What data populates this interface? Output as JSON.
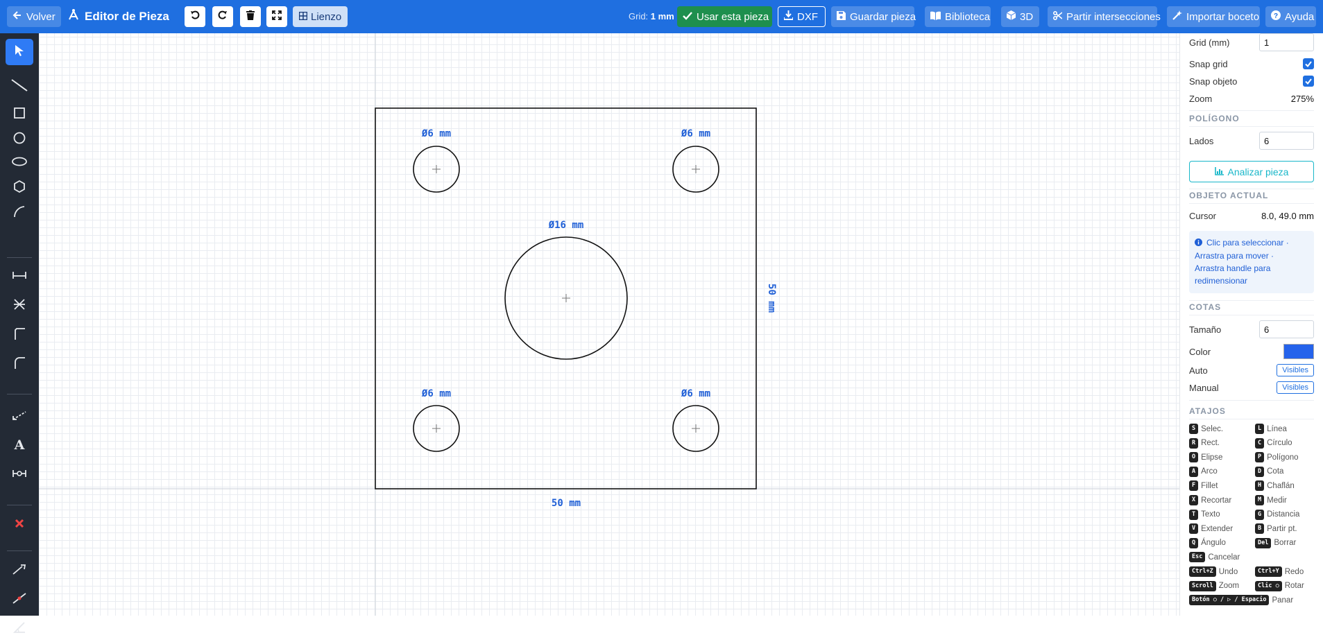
{
  "header": {
    "back_label": "Volver",
    "title": "Editor de Pieza",
    "lienzo_label": "Lienzo",
    "grid_prefix": "Grid:",
    "grid_value": "1 mm",
    "usar_label": "Usar esta pieza",
    "dxf_label": "DXF",
    "guardar_label": "Guardar pieza",
    "biblioteca_label": "Biblioteca",
    "d3_label": "3D",
    "partir_label": "Partir intersecciones",
    "importar_label": "Importar boceto",
    "ayuda_label": "Ayuda"
  },
  "drawing": {
    "hole_small_label": "Ø6 mm",
    "hole_big_label": "Ø16 mm",
    "width_label": "50 mm",
    "height_label": "50 mm",
    "small_hole_diameter_mm": 6,
    "big_hole_diameter_mm": 16,
    "plate_width_mm": 50,
    "plate_height_mm": 50
  },
  "panel": {
    "grid_label": "Grid (mm)",
    "grid_value": "1",
    "snap_grid_label": "Snap grid",
    "snap_objeto_label": "Snap objeto",
    "zoom_label": "Zoom",
    "zoom_value": "275%",
    "poligono_title": "POLÍGONO",
    "lados_label": "Lados",
    "lados_value": "6",
    "analizar_label": "Analizar pieza",
    "objeto_title": "OBJETO ACTUAL",
    "cursor_label": "Cursor",
    "cursor_value": "8.0, 49.0 mm",
    "info_line1": "Clic para seleccionar ·",
    "info_line2": "Arrastra para mover ·",
    "info_line3": "Arrastra handle para",
    "info_line4": "redimensionar",
    "cotas_title": "COTAS",
    "tamano_label": "Tamaño",
    "tamano_value": "6",
    "color_label": "Color",
    "color_value": "#2563eb",
    "auto_label": "Auto",
    "auto_value": "Visibles",
    "manual_label": "Manual",
    "manual_value": "Visibles",
    "atajos_title": "ATAJOS"
  },
  "shortcuts": [
    {
      "key": "S",
      "label": "Selec."
    },
    {
      "key": "L",
      "label": "Línea"
    },
    {
      "key": "R",
      "label": "Rect."
    },
    {
      "key": "C",
      "label": "Círculo"
    },
    {
      "key": "O",
      "label": "Elipse"
    },
    {
      "key": "P",
      "label": "Polígono"
    },
    {
      "key": "A",
      "label": "Arco"
    },
    {
      "key": "D",
      "label": "Cota"
    },
    {
      "key": "F",
      "label": "Fillet"
    },
    {
      "key": "H",
      "label": "Chaflán"
    },
    {
      "key": "X",
      "label": "Recortar"
    },
    {
      "key": "M",
      "label": "Medir"
    },
    {
      "key": "T",
      "label": "Texto"
    },
    {
      "key": "G",
      "label": "Distancia"
    },
    {
      "key": "V",
      "label": "Extender"
    },
    {
      "key": "B",
      "label": "Partir pt."
    },
    {
      "key": "Q",
      "label": "Ángulo"
    },
    {
      "key": "Del",
      "label": "Borrar"
    },
    {
      "key": "Esc",
      "label": "Cancelar"
    },
    {
      "key": "Ctrl+Z",
      "label": "Undo"
    },
    {
      "key": "Ctrl+Y",
      "label": "Redo"
    },
    {
      "key": "Scroll",
      "label": "Zoom"
    },
    {
      "key": "Clic ○",
      "label": "Rotar"
    },
    {
      "key": "Botón ○ / ▷ / Espacio",
      "label": "Panar"
    }
  ],
  "colors": {
    "topbar": "#1f6fe0",
    "toolbar": "#232a35",
    "dimension": "#1f5fd6",
    "usar_button": "#1e8f4e"
  }
}
